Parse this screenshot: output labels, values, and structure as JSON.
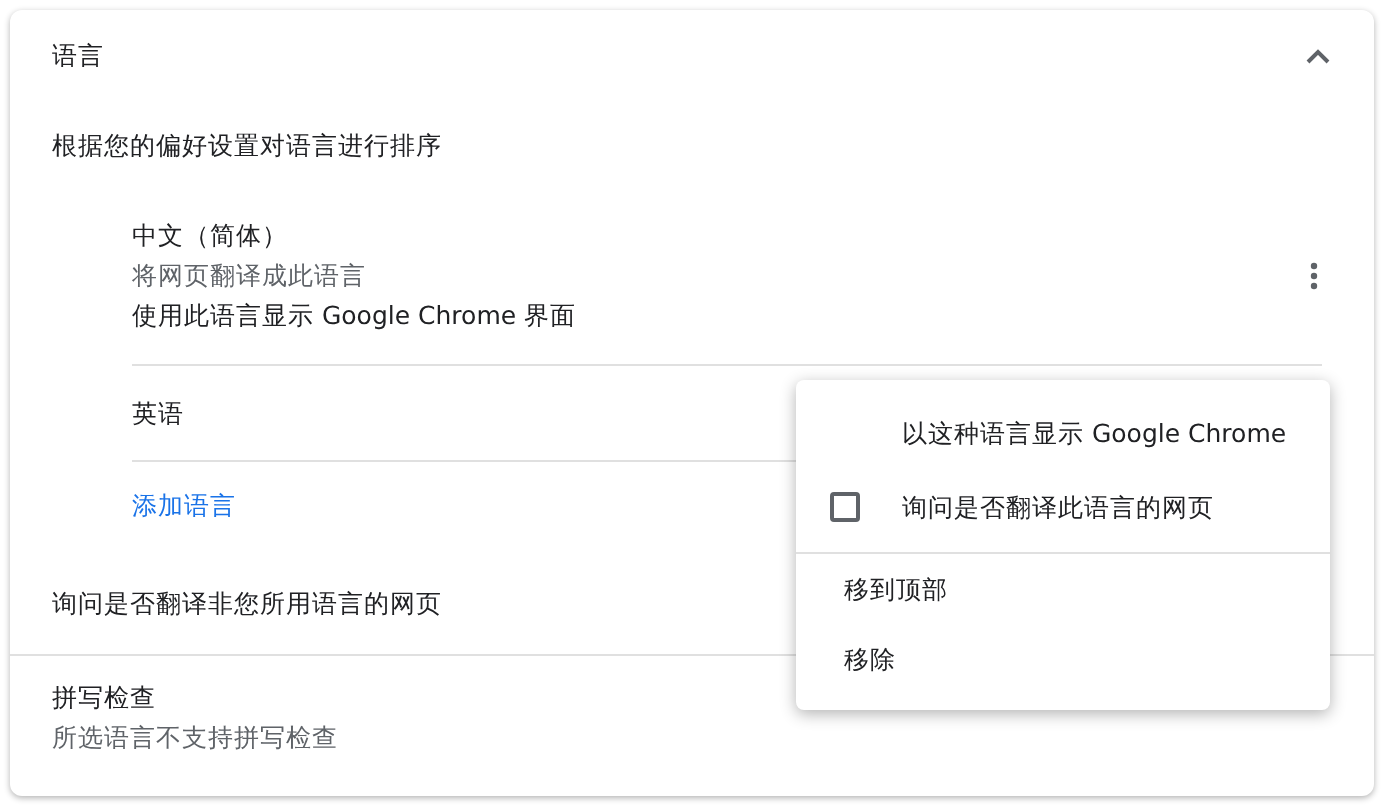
{
  "section": {
    "title": "语言",
    "expanded": true
  },
  "order_label": "根据您的偏好设置对语言进行排序",
  "languages": [
    {
      "name": "中文（简体）",
      "lines": [
        "将网页翻译成此语言",
        "使用此语言显示 Google Chrome 界面"
      ],
      "has_menu": true
    },
    {
      "name": "英语"
    }
  ],
  "add_language": "添加语言",
  "translate_prompt": "询问是否翻译非您所用语言的网页",
  "spellcheck": {
    "title": "拼写检查",
    "subtitle": "所选语言不支持拼写检查"
  },
  "menu": [
    {
      "kind": "option",
      "label": "以这种语言显示 Google Chrome"
    },
    {
      "kind": "checkbox",
      "label": "询问是否翻译此语言的网页",
      "checked": false
    },
    {
      "kind": "divider"
    },
    {
      "kind": "action",
      "label": "移到顶部"
    },
    {
      "kind": "action",
      "label": "移除"
    }
  ]
}
